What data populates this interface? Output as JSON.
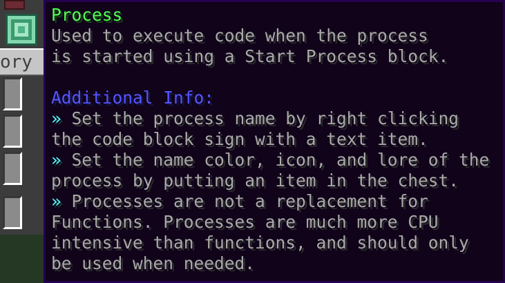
{
  "inventory": {
    "tab_label": "ory"
  },
  "tooltip": {
    "title": "Process",
    "description": [
      "Used to execute code when the process",
      "is started using a Start Process block."
    ],
    "section_heading": "Additional Info:",
    "bullet_glyph": "»",
    "bullets": [
      {
        "lines": [
          " Set the process name by right clicking",
          "the code block sign with a text item."
        ]
      },
      {
        "lines": [
          " Set the name color, icon, and lore of the",
          "process by putting an item in the chest."
        ]
      },
      {
        "lines": [
          " Processes are not a replacement for",
          "Functions. Processes are much more CPU",
          "intensive than functions, and should only",
          "be used when needed."
        ]
      }
    ],
    "colors": {
      "title": "#55ff55",
      "section_heading": "#5555ff",
      "bullet": "#55ffff",
      "body": "#aaaaaa",
      "background": "#10031a",
      "border": "#250150"
    }
  }
}
